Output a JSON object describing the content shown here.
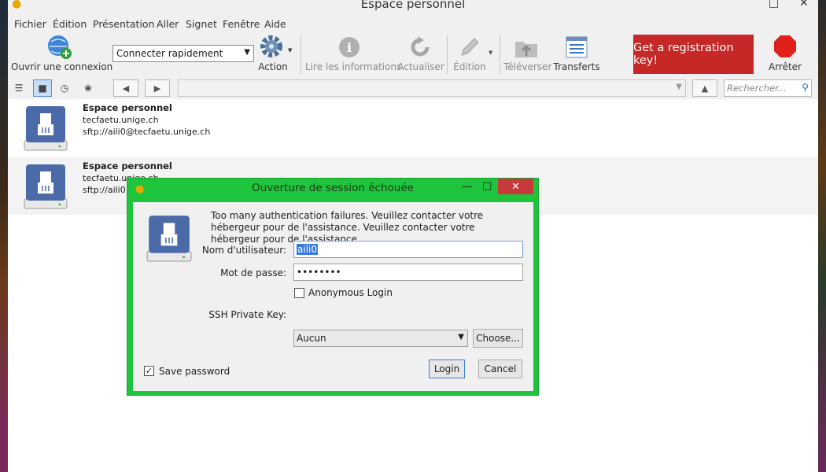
{
  "window": {
    "title": "Espace personnel"
  },
  "menu": [
    "Fichier",
    "Édition",
    "Présentation",
    "Aller",
    "Signet",
    "Fenêtre",
    "Aide"
  ],
  "toolbar": {
    "open_connection": "Ouvrir une connexion",
    "quick_connect": "Connecter rapidement",
    "action": "Action",
    "info": "Lire les informations",
    "refresh": "Actualiser",
    "edit": "Édition",
    "upload": "Téléverser",
    "transfers": "Transferts",
    "registration": "Get a registration key!",
    "stop": "Arrêter"
  },
  "search": {
    "placeholder": "Rechercher..."
  },
  "bookmarks": [
    {
      "name": "Espace personnel",
      "host": "tecfaetu.unige.ch",
      "url": "sftp://aili0@tecfaetu.unige.ch"
    },
    {
      "name": "Espace personnel",
      "host": "tecfaetu.unige.ch",
      "url": "sftp://aili0"
    }
  ],
  "dialog": {
    "title": "Ouverture de session échouée",
    "message": "Too many authentication failures. Veuillez contacter votre hébergeur pour de l'assistance. Veuillez contacter votre hébergeur pour de l'assistance.",
    "username_label": "Nom d'utilisateur:",
    "username_value": "aili0",
    "password_label": "Mot de passe:",
    "password_value": "••••••••",
    "anonymous_label": "Anonymous Login",
    "anonymous_checked": false,
    "ssh_key_label": "SSH Private Key:",
    "ssh_key_value": "Aucun",
    "choose_button": "Choose...",
    "save_password_label": "Save password",
    "save_password_checked": true,
    "login_button": "Login",
    "cancel_button": "Cancel"
  },
  "colors": {
    "dialog_frame": "#1ec43c",
    "registration": "#c62828",
    "close": "#c83a3a"
  }
}
